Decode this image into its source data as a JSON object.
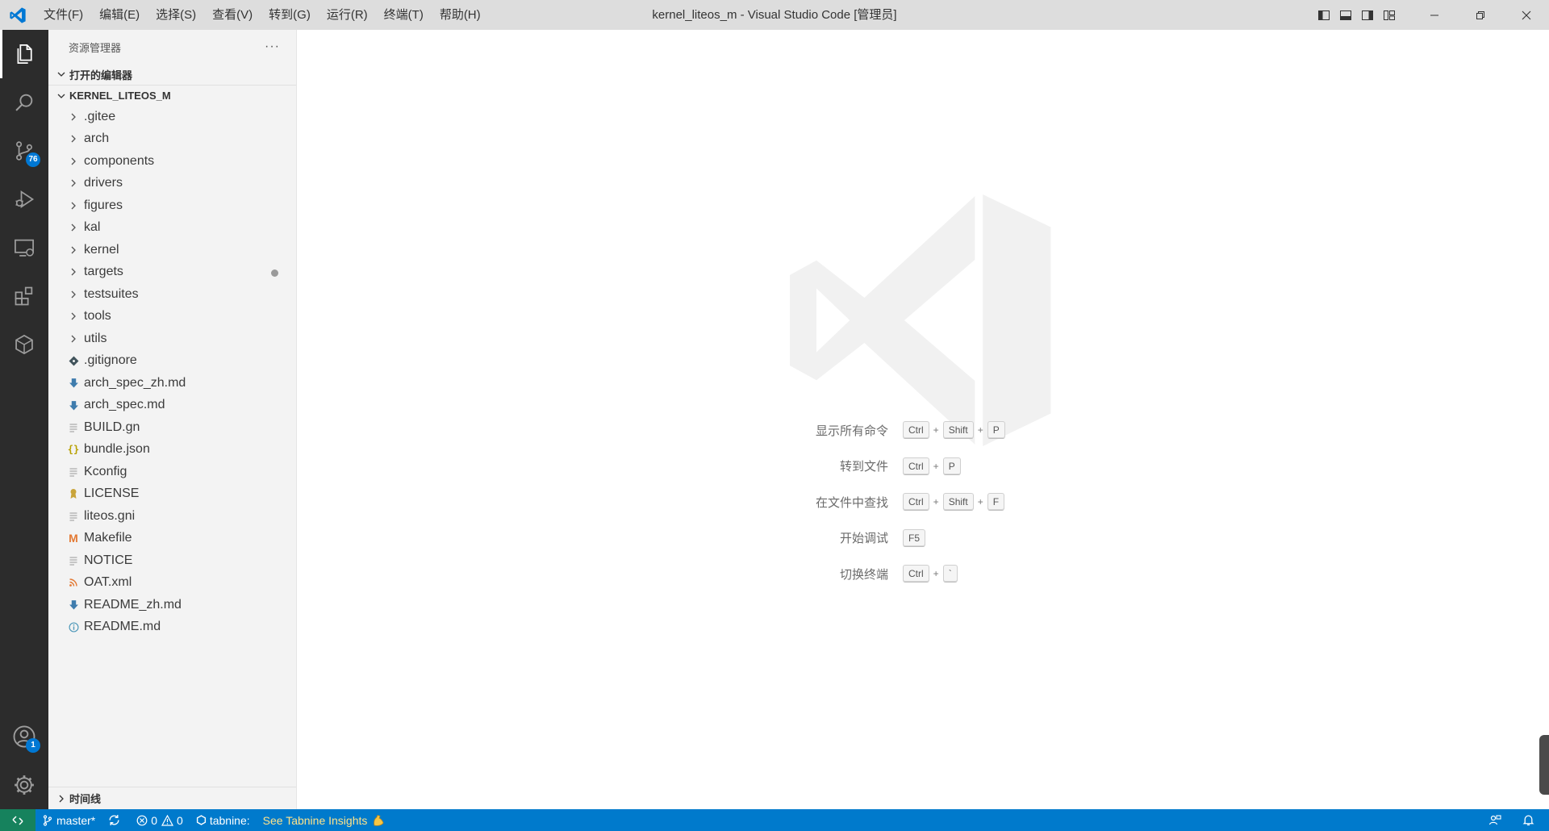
{
  "window": {
    "title": "kernel_liteos_m - Visual Studio Code [管理员]"
  },
  "menu": {
    "items": [
      "文件(F)",
      "编辑(E)",
      "选择(S)",
      "查看(V)",
      "转到(G)",
      "运行(R)",
      "终端(T)",
      "帮助(H)"
    ]
  },
  "activity": {
    "scm_badge": "76",
    "accounts_badge": "1"
  },
  "explorer": {
    "title": "资源管理器",
    "more": "···",
    "open_editors": "打开的编辑器",
    "workspace": "KERNEL_LITEOS_M",
    "folders": [
      ".gitee",
      "arch",
      "components",
      "drivers",
      "figures",
      "kal",
      "kernel",
      "targets",
      "testsuites",
      "tools",
      "utils"
    ],
    "files": [
      {
        "name": ".gitignore",
        "icon": "git-icon"
      },
      {
        "name": "arch_spec_zh.md",
        "icon": "markdown-down-icon"
      },
      {
        "name": "arch_spec.md",
        "icon": "markdown-down-icon"
      },
      {
        "name": "BUILD.gn",
        "icon": "lines-icon"
      },
      {
        "name": "bundle.json",
        "icon": "json-braces-icon"
      },
      {
        "name": "Kconfig",
        "icon": "lines-icon"
      },
      {
        "name": "LICENSE",
        "icon": "license-icon"
      },
      {
        "name": "liteos.gni",
        "icon": "lines-icon"
      },
      {
        "name": "Makefile",
        "icon": "makefile-m-icon"
      },
      {
        "name": "NOTICE",
        "icon": "lines-icon"
      },
      {
        "name": "OAT.xml",
        "icon": "rss-icon"
      },
      {
        "name": "README_zh.md",
        "icon": "markdown-down-icon"
      },
      {
        "name": "README.md",
        "icon": "info-icon"
      }
    ],
    "timeline": "时间线"
  },
  "welcome": {
    "shortcuts": [
      {
        "label": "显示所有命令",
        "keys": [
          "Ctrl",
          "Shift",
          "P"
        ]
      },
      {
        "label": "转到文件",
        "keys": [
          "Ctrl",
          "P"
        ]
      },
      {
        "label": "在文件中查找",
        "keys": [
          "Ctrl",
          "Shift",
          "F"
        ]
      },
      {
        "label": "开始调试",
        "keys": [
          "F5"
        ]
      },
      {
        "label": "切换终端",
        "keys": [
          "Ctrl",
          "`"
        ]
      }
    ]
  },
  "status": {
    "branch": "master*",
    "errors": "0",
    "warnings": "0",
    "tabnine": "tabnine:",
    "insights": "See Tabnine Insights"
  },
  "colors": {
    "accent": "#007acc",
    "remote": "#16825d",
    "activity_bg": "#2c2c2c",
    "sidebar_bg": "#f3f3f3",
    "badge": "#0078d4"
  }
}
